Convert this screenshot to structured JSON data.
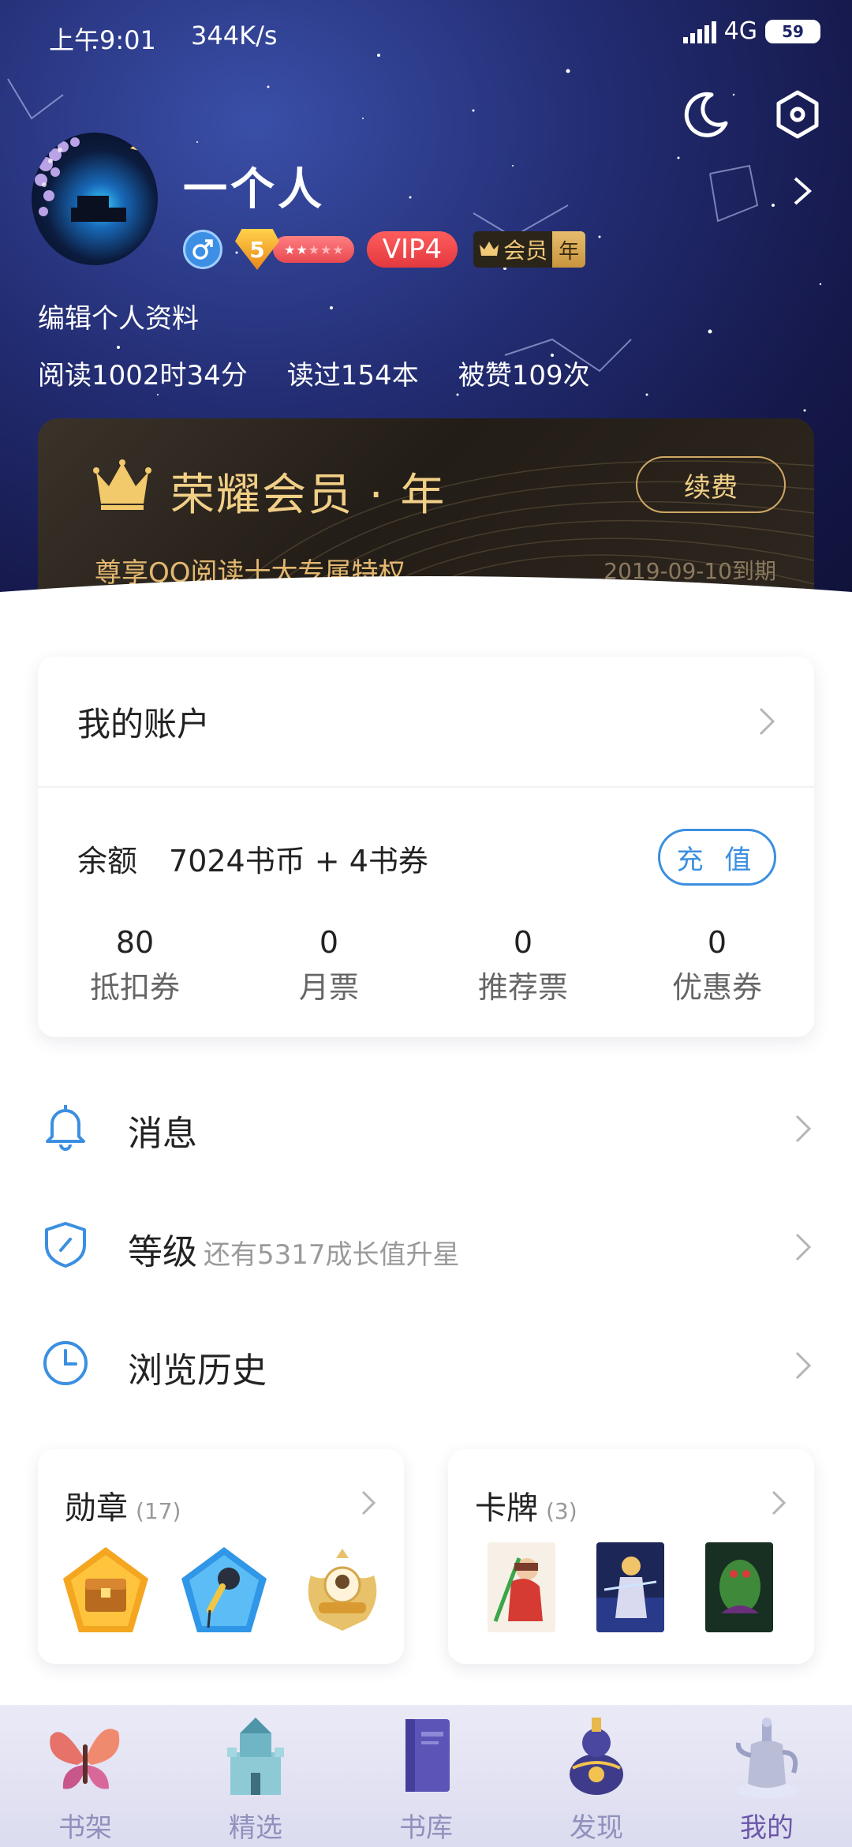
{
  "status_bar": {
    "time": "上午9:01",
    "speed": "344K/s",
    "network": "4G",
    "battery": "59"
  },
  "profile": {
    "username": "一个人",
    "level": "5",
    "vip": "VIP4",
    "member_label": "会员",
    "member_period": "年",
    "edit_link": "编辑个人资料",
    "stats": {
      "read_time": "阅读1002时34分",
      "books_read": "读过154本",
      "likes": "被赞109次"
    }
  },
  "vip_card": {
    "title": "荣耀会员 · 年",
    "subtitle": "尊享QQ阅读十大专属特权",
    "expire": "2019-09-10到期",
    "renew_label": "续费"
  },
  "account": {
    "title": "我的账户",
    "balance_label": "余额",
    "balance_value": "7024书币 + 4书券",
    "recharge_label": "充 值",
    "tickets": [
      {
        "value": "80",
        "label": "抵扣券"
      },
      {
        "value": "0",
        "label": "月票"
      },
      {
        "value": "0",
        "label": "推荐票"
      },
      {
        "value": "0",
        "label": "优惠券"
      }
    ]
  },
  "menu": {
    "messages": "消息",
    "level": "等级",
    "level_sub": "还有5317成长值升星",
    "history": "浏览历史"
  },
  "medals": {
    "title": "勋章",
    "count": "(17)"
  },
  "cards": {
    "title": "卡牌",
    "count": "(3)"
  },
  "bottom_nav": [
    {
      "label": "书架",
      "icon": "butterfly-icon"
    },
    {
      "label": "精选",
      "icon": "castle-icon"
    },
    {
      "label": "书库",
      "icon": "book-icon"
    },
    {
      "label": "发现",
      "icon": "gourd-icon"
    },
    {
      "label": "我的",
      "icon": "teapot-icon"
    }
  ],
  "colors": {
    "accent_blue": "#3b8fe0",
    "gold": "#f1cf86",
    "nav_active": "#6b57a8"
  }
}
